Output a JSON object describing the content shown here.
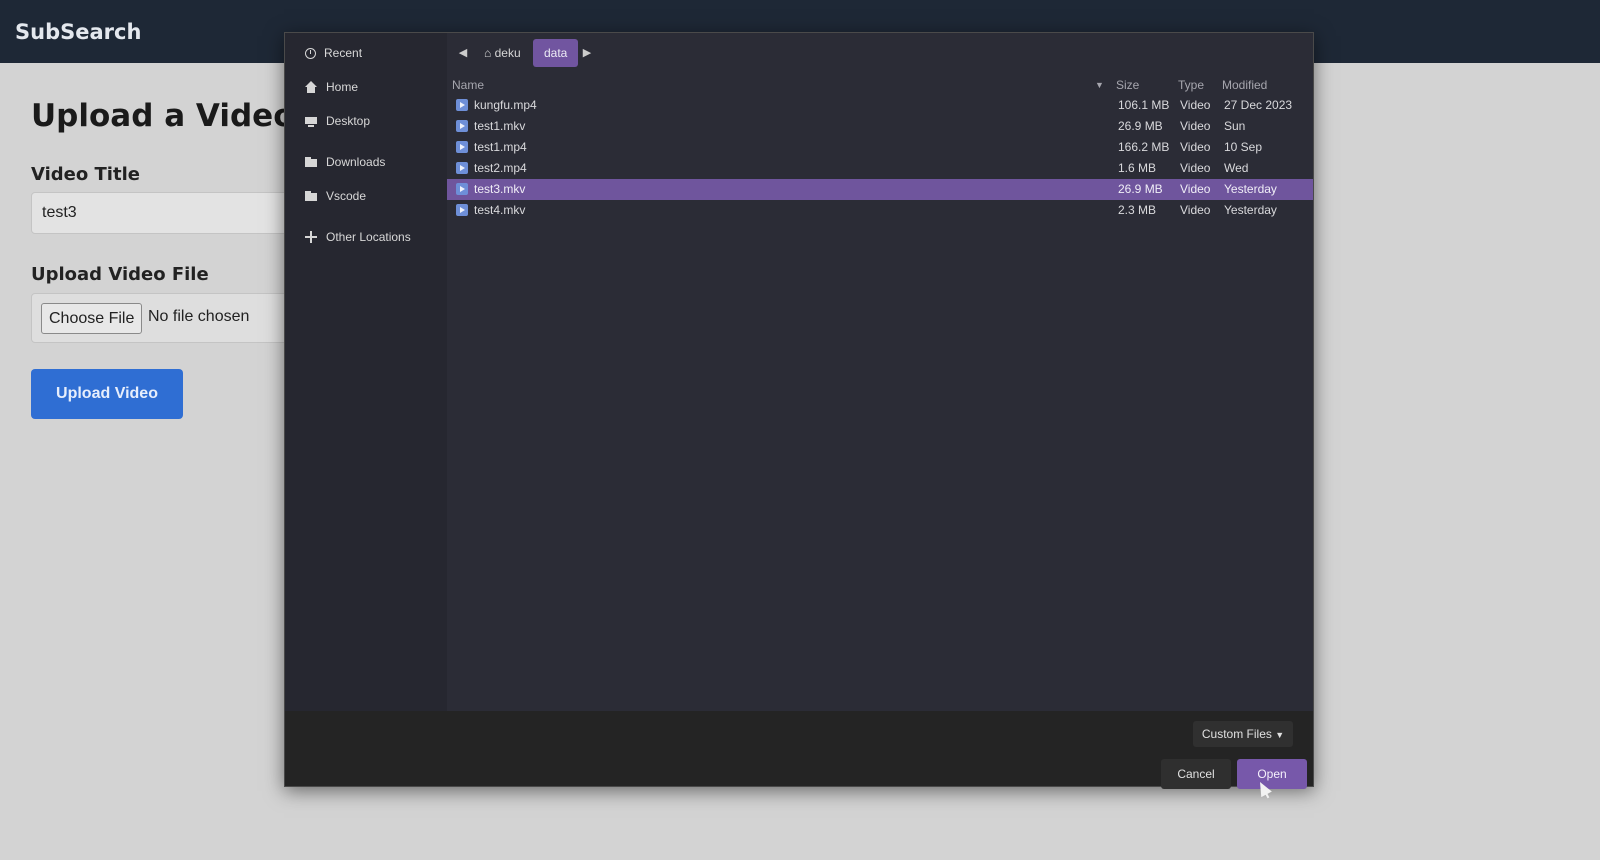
{
  "app": {
    "brand": "SubSearch"
  },
  "page": {
    "title": "Upload a Video",
    "video_title_label": "Video Title",
    "video_title_value": "test3",
    "upload_file_label": "Upload Video File",
    "choose_file_label": "Choose File",
    "no_file_text": "No file chosen",
    "upload_button_label": "Upload Video"
  },
  "dialog": {
    "sidebar": [
      {
        "label": "Recent",
        "icon": "clock-icon"
      },
      {
        "label": "Home",
        "icon": "home-icon"
      },
      {
        "label": "Desktop",
        "icon": "desktop-icon"
      },
      {
        "label": "Downloads",
        "icon": "folder-icon"
      },
      {
        "label": "Vscode",
        "icon": "folder-icon"
      },
      {
        "label": "Other Locations",
        "icon": "plus-icon"
      }
    ],
    "path": [
      "deku",
      "data"
    ],
    "columns": {
      "name": "Name",
      "size": "Size",
      "type": "Type",
      "modified": "Modified"
    },
    "files": [
      {
        "name": "kungfu.mp4",
        "size": "106.1 MB",
        "type": "Video",
        "modified": "27 Dec 2023",
        "selected": false
      },
      {
        "name": "test1.mkv",
        "size": "26.9 MB",
        "type": "Video",
        "modified": "Sun",
        "selected": false
      },
      {
        "name": "test1.mp4",
        "size": "166.2 MB",
        "type": "Video",
        "modified": "10 Sep",
        "selected": false
      },
      {
        "name": "test2.mp4",
        "size": "1.6 MB",
        "type": "Video",
        "modified": "Wed",
        "selected": false
      },
      {
        "name": "test3.mkv",
        "size": "26.9 MB",
        "type": "Video",
        "modified": "Yesterday",
        "selected": true
      },
      {
        "name": "test4.mkv",
        "size": "2.3 MB",
        "type": "Video",
        "modified": "Yesterday",
        "selected": false
      }
    ],
    "filter_label": "Custom Files",
    "cancel_label": "Cancel",
    "open_label": "Open"
  },
  "colors": {
    "selection": "#6f559d",
    "primary_button": "#2f6ed3",
    "open_button": "#7758aa"
  }
}
